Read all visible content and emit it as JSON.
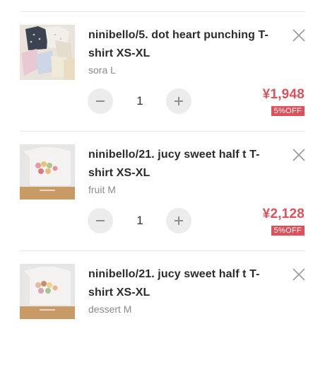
{
  "cart": {
    "items": [
      {
        "title": "ninibello/5. dot heart punching T-shirt XS-XL",
        "variant": "sora L",
        "quantity": "1",
        "price": "¥1,948",
        "discount": "5%OFF",
        "thumbnail": "tshirt-pile-photo"
      },
      {
        "title": "ninibello/21. jucy sweet half t T-shirt XS-XL",
        "variant": "fruit M",
        "quantity": "1",
        "price": "¥2,128",
        "discount": "5%OFF",
        "thumbnail": "folded-tshirt-fruit-print-photo"
      },
      {
        "title": "ninibello/21. jucy sweet half t T-shirt XS-XL",
        "variant": "dessert M",
        "thumbnail": "folded-tshirt-dessert-print-photo"
      }
    ],
    "icons": {
      "remove": "close-icon",
      "decrease": "minus-icon",
      "increase": "plus-icon"
    },
    "colors": {
      "price": "#e0505a",
      "discount_badge": "#e0505a",
      "stepper_bg": "#ececec"
    }
  }
}
